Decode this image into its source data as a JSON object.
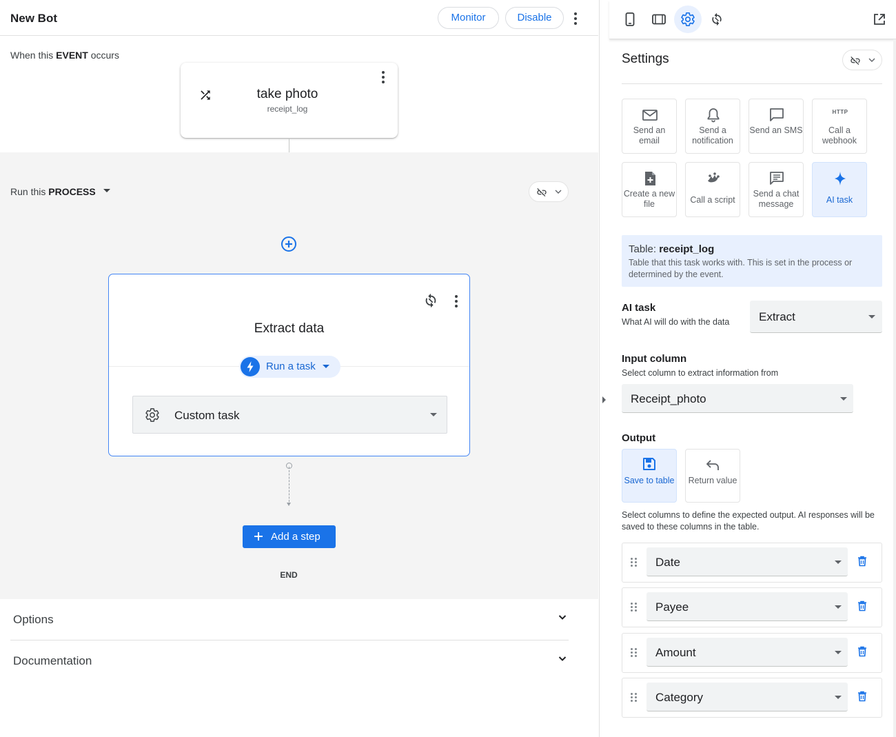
{
  "header": {
    "bot_title": "New Bot",
    "monitor_label": "Monitor",
    "disable_label": "Disable"
  },
  "event": {
    "prefix": "When this",
    "keyword": "EVENT",
    "suffix": "occurs",
    "card_title": "take photo",
    "card_table": "receipt_log"
  },
  "process": {
    "prefix": "Run this",
    "keyword": "PROCESS",
    "step_title": "Extract data",
    "run_task_label": "Run a task",
    "task_select_value": "Custom task",
    "add_step_label": "Add a step",
    "end_label": "END"
  },
  "accordions": {
    "options": "Options",
    "documentation": "Documentation"
  },
  "panel": {
    "title": "Settings",
    "tiles": [
      {
        "label": "Send an email",
        "icon": "email-icon"
      },
      {
        "label": "Send a notification",
        "icon": "bell-icon"
      },
      {
        "label": "Send an SMS",
        "icon": "sms-icon"
      },
      {
        "label": "Call a webhook",
        "icon": "http-icon",
        "icon_text": "HTTP"
      },
      {
        "label": "Create a new file",
        "icon": "new-file-icon"
      },
      {
        "label": "Call a script",
        "icon": "script-icon"
      },
      {
        "label": "Send a chat message",
        "icon": "chat-icon"
      },
      {
        "label": "AI task",
        "icon": "sparkle-icon",
        "selected": true
      }
    ],
    "table_info": {
      "label": "Table:",
      "table_name": "receipt_log",
      "description": "Table that this task works with. This is set in the process or determined by the event."
    },
    "ai_task": {
      "title": "AI task",
      "description": "What AI will do with the data",
      "value": "Extract"
    },
    "input_column": {
      "title": "Input column",
      "description": "Select column to extract information from",
      "value": "Receipt_photo"
    },
    "output": {
      "title": "Output",
      "options": [
        {
          "label": "Save to table",
          "icon": "save-icon",
          "selected": true
        },
        {
          "label": "Return value",
          "icon": "return-icon",
          "selected": false
        }
      ],
      "description": "Select columns to define the expected output. AI responses will be saved to these columns in the table.",
      "columns": [
        "Date",
        "Payee",
        "Amount",
        "Category"
      ]
    }
  },
  "colors": {
    "accent": "#1a73e8",
    "accent_light": "#e8f0fe",
    "process_bg": "#f4f4f4",
    "text": "#202124",
    "muted": "#5f6368"
  }
}
